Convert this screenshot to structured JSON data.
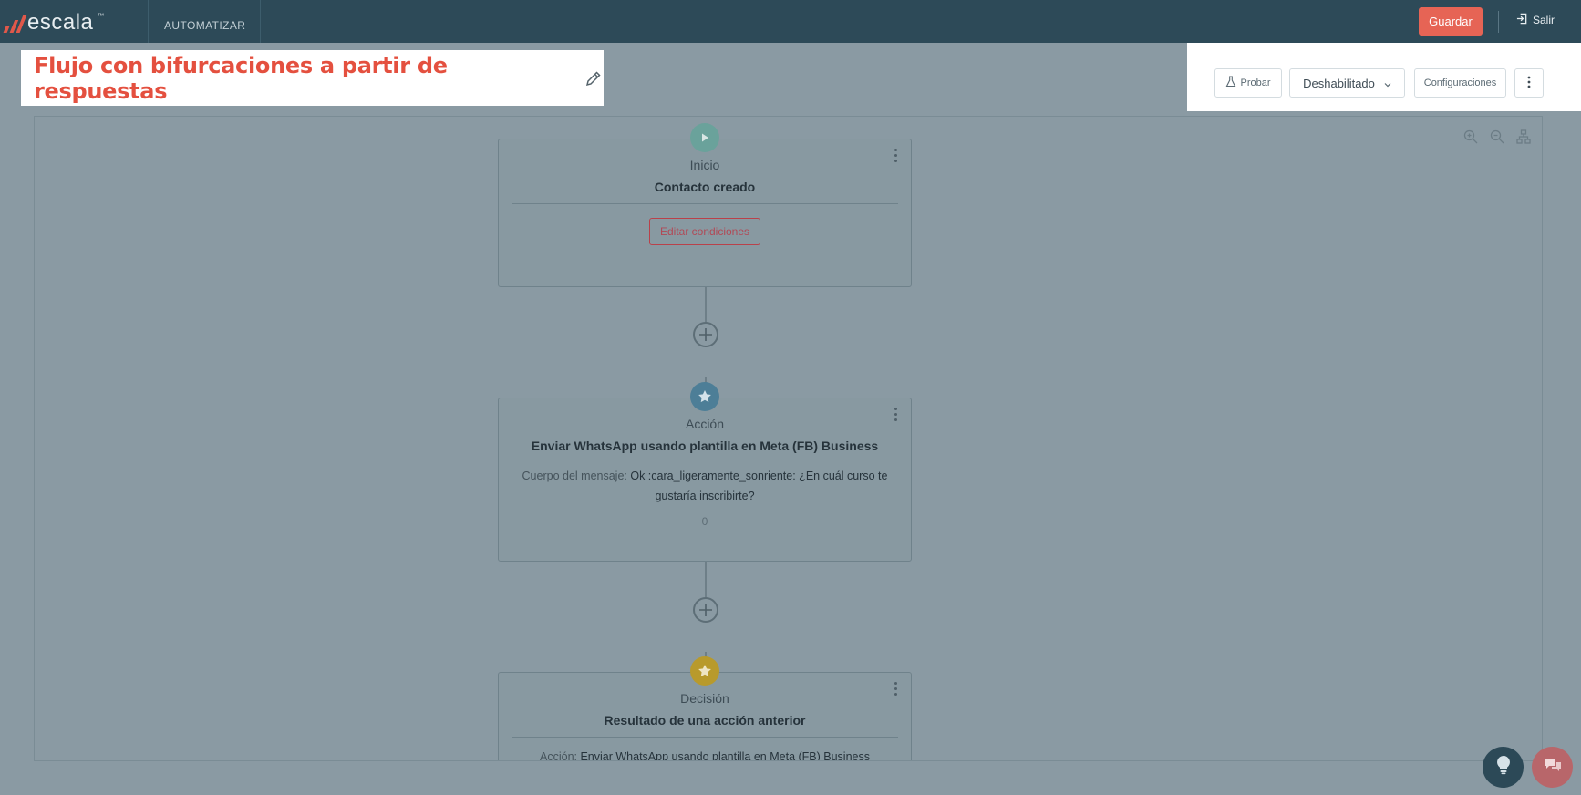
{
  "header": {
    "logo_text": "escala",
    "logo_tm": "™",
    "nav_item": "AUTOMATIZAR",
    "save_label": "Guardar",
    "exit_label": "Salir"
  },
  "flow": {
    "title": "Flujo con bifurcaciones a partir de respuestas"
  },
  "toolbar": {
    "test_label": "Probar",
    "status_value": "Deshabilitado",
    "settings_label": "Configuraciones"
  },
  "nodes": [
    {
      "kind": "Inicio",
      "title": "Contacto creado",
      "button_label": "Editar condiciones",
      "badge_color": "#6aa29b"
    },
    {
      "kind": "Acción",
      "title": "Enviar WhatsApp usando plantilla en Meta (FB) Business",
      "body_label": "Cuerpo del mensaje: ",
      "body_text": "Ok :cara_ligeramente_sonriente: ¿En cuál curso te gustaría inscribirte?",
      "count": "0",
      "badge_color": "#4d7e97"
    },
    {
      "kind": "Decisión",
      "title": "Resultado de una acción anterior",
      "body_label": "Acción: ",
      "body_text": "Enviar WhatsApp usando plantilla en Meta (FB) Business",
      "badge_color": "#b89a2c"
    }
  ],
  "colors": {
    "topbar": "#2d4a58",
    "accent": "#e66455",
    "title": "#e4503f"
  }
}
